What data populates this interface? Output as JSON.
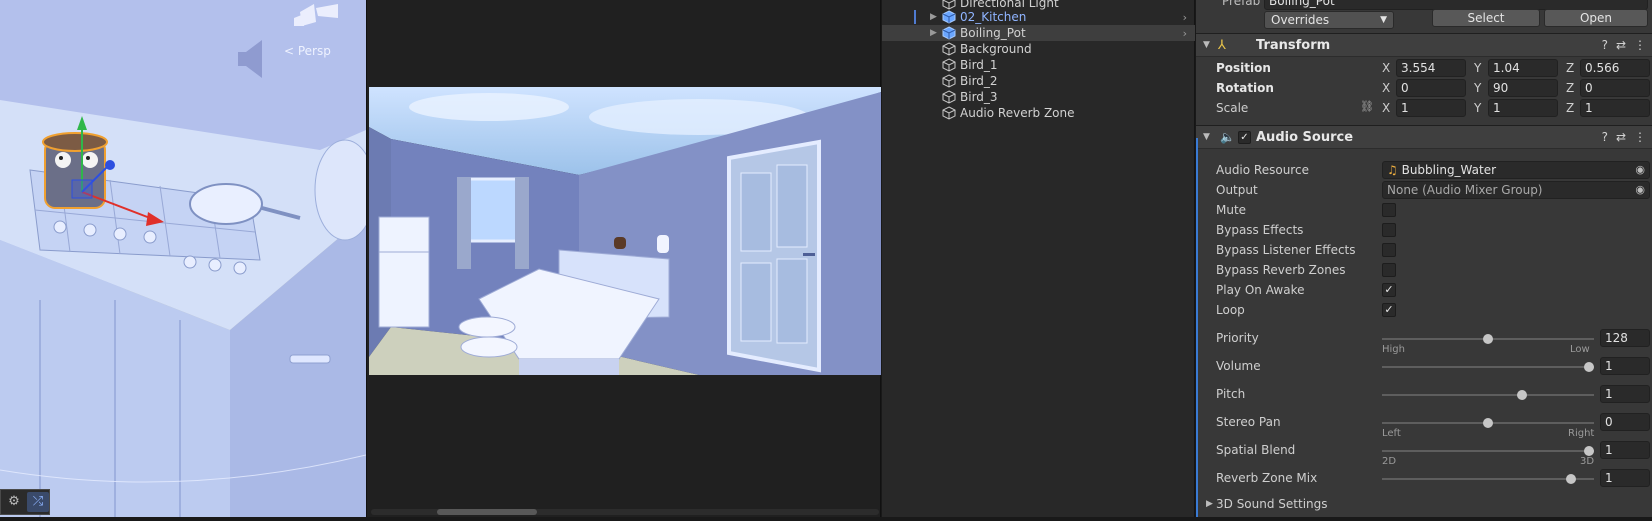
{
  "scene": {
    "persp_label": "< Persp"
  },
  "hierarchy": {
    "items": [
      {
        "label": "Directional Light",
        "prefab": false,
        "selected": false,
        "expandable": false
      },
      {
        "label": "02_Kitchen",
        "prefab": true,
        "selected": false,
        "expandable": true
      },
      {
        "label": "Boiling_Pot",
        "prefab": true,
        "selected": true,
        "expandable": true
      },
      {
        "label": "Background",
        "prefab": false,
        "selected": false,
        "expandable": false
      },
      {
        "label": "Bird_1",
        "prefab": false,
        "selected": false,
        "expandable": false
      },
      {
        "label": "Bird_2",
        "prefab": false,
        "selected": false,
        "expandable": false
      },
      {
        "label": "Bird_3",
        "prefab": false,
        "selected": false,
        "expandable": false
      },
      {
        "label": "Audio Reverb Zone",
        "prefab": false,
        "selected": false,
        "expandable": false
      }
    ]
  },
  "inspector": {
    "prefab_label": "Prefab",
    "prefab_value": "Boiling_Pot",
    "overrides_label": "Overrides",
    "select_label": "Select",
    "open_label": "Open",
    "transform": {
      "title": "Transform",
      "position_label": "Position",
      "rotation_label": "Rotation",
      "scale_label": "Scale",
      "position": {
        "x": "3.554",
        "y": "1.04",
        "z": "0.566"
      },
      "rotation": {
        "x": "0",
        "y": "90",
        "z": "0"
      },
      "scale": {
        "x": "1",
        "y": "1",
        "z": "1"
      },
      "axis_x": "X",
      "axis_y": "Y",
      "axis_z": "Z"
    },
    "audio_source": {
      "title": "Audio Source",
      "enabled": true,
      "audio_resource_label": "Audio Resource",
      "audio_resource_value": "Bubbling_Water",
      "output_label": "Output",
      "output_value": "None (Audio Mixer Group)",
      "mute_label": "Mute",
      "mute": false,
      "bypass_effects_label": "Bypass Effects",
      "bypass_effects": false,
      "bypass_listener_label": "Bypass Listener Effects",
      "bypass_listener": false,
      "bypass_reverb_label": "Bypass Reverb Zones",
      "bypass_reverb": false,
      "play_on_awake_label": "Play On Awake",
      "play_on_awake": true,
      "loop_label": "Loop",
      "loop": true,
      "priority_label": "Priority",
      "priority_value": "128",
      "priority_fraction": 0.5,
      "priority_low_cap": "High",
      "priority_high_cap": "Low",
      "volume_label": "Volume",
      "volume_value": "1",
      "volume_fraction": 1.0,
      "pitch_label": "Pitch",
      "pitch_value": "1",
      "pitch_fraction": 0.667,
      "stereo_pan_label": "Stereo Pan",
      "stereo_pan_value": "0",
      "stereo_pan_fraction": 0.5,
      "stereo_left_cap": "Left",
      "stereo_right_cap": "Right",
      "spatial_blend_label": "Spatial Blend",
      "spatial_blend_value": "1",
      "spatial_blend_fraction": 1.0,
      "spatial_2d_cap": "2D",
      "spatial_3d_cap": "3D",
      "reverb_mix_label": "Reverb Zone Mix",
      "reverb_mix_value": "1",
      "reverb_mix_fraction": 0.909,
      "sound_3d_label": "3D Sound Settings"
    }
  },
  "colors": {
    "accent_blue": "#3a7bd5",
    "prefab_blue": "#8fb4ff",
    "panel_bg": "#383838"
  }
}
